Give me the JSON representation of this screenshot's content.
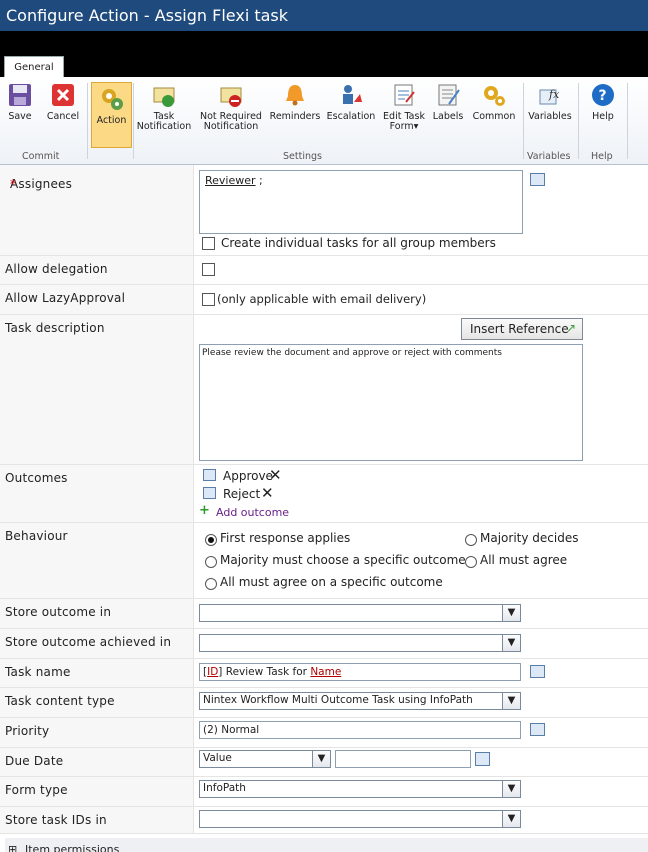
{
  "window": {
    "title": "Configure Action - Assign Flexi task"
  },
  "tabs": [
    {
      "label": "General"
    }
  ],
  "ribbon": {
    "buttons": [
      {
        "label": "Save",
        "icon": "save-icon"
      },
      {
        "label": "Cancel",
        "icon": "cancel-icon"
      },
      {
        "label": "Action",
        "icon": "action-gear-icon"
      },
      {
        "label1": "Task",
        "label2": "Notification",
        "icon": "task-notification-icon"
      },
      {
        "label1": "Not Required",
        "label2": "Notification",
        "icon": "not-required-notification-icon"
      },
      {
        "label": "Reminders",
        "icon": "bell-icon"
      },
      {
        "label": "Escalation",
        "icon": "escalation-icon"
      },
      {
        "label1": "Edit Task",
        "label2": "Form",
        "icon": "edit-task-form-icon"
      },
      {
        "label": "Labels",
        "icon": "labels-icon"
      },
      {
        "label": "Common",
        "icon": "common-gears-icon"
      },
      {
        "label": "Variables",
        "icon": "variables-fx-icon"
      },
      {
        "label": "Help",
        "icon": "help-icon"
      }
    ],
    "groups": {
      "commit": "Commit",
      "settings": "Settings",
      "variables": "Variables",
      "help": "Help"
    }
  },
  "form": {
    "assignees": {
      "label": "Assignees",
      "required_mark": "*",
      "value": "Reviewer",
      "suffix": ";",
      "group_checkbox_label": "Create individual tasks for all group members"
    },
    "allow_delegation": {
      "label": "Allow delegation"
    },
    "allow_lazy": {
      "label": "Allow LazyApproval",
      "note": "(only applicable with email delivery)"
    },
    "task_description": {
      "label": "Task description",
      "insert_reference": "Insert Reference",
      "text": "Please review the document and approve or reject with comments"
    },
    "outcomes": {
      "label": "Outcomes",
      "items": [
        "Approve",
        "Reject"
      ],
      "add_label": "Add outcome"
    },
    "behaviour": {
      "label": "Behaviour",
      "options": [
        "First response applies",
        "Majority decides",
        "Majority must choose a specific outcome",
        "All must agree",
        "All must agree on a specific outcome"
      ],
      "selected": "First response applies"
    },
    "store_outcome": {
      "label": "Store outcome in",
      "value": ""
    },
    "store_outcome_achieved": {
      "label": "Store outcome achieved in",
      "value": ""
    },
    "task_name": {
      "label": "Task name",
      "id_ref": "ID",
      "middle": " Review Task for ",
      "name_ref": "Name"
    },
    "task_content_type": {
      "label": "Task content type",
      "value": "Nintex Workflow Multi Outcome Task using InfoPath"
    },
    "priority": {
      "label": "Priority",
      "value": "(2) Normal"
    },
    "due_date": {
      "label": "Due Date",
      "value": "Value"
    },
    "form_type": {
      "label": "Form type",
      "value": "InfoPath"
    },
    "store_task_ids": {
      "label": "Store task IDs in",
      "value": ""
    },
    "item_permissions": {
      "label": "Item permissions"
    }
  }
}
